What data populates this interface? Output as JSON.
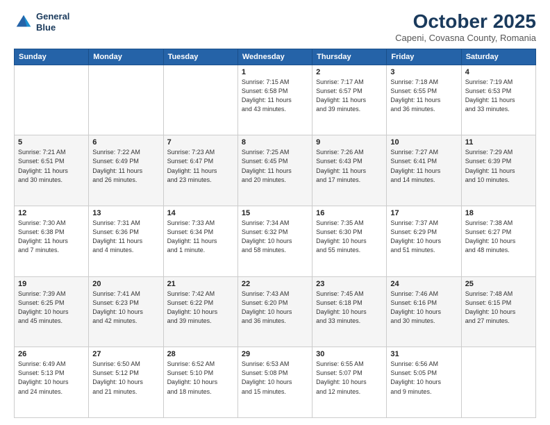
{
  "logo": {
    "line1": "General",
    "line2": "Blue"
  },
  "title": "October 2025",
  "subtitle": "Capeni, Covasna County, Romania",
  "days_header": [
    "Sunday",
    "Monday",
    "Tuesday",
    "Wednesday",
    "Thursday",
    "Friday",
    "Saturday"
  ],
  "weeks": [
    [
      {
        "num": "",
        "info": ""
      },
      {
        "num": "",
        "info": ""
      },
      {
        "num": "",
        "info": ""
      },
      {
        "num": "1",
        "info": "Sunrise: 7:15 AM\nSunset: 6:58 PM\nDaylight: 11 hours\nand 43 minutes."
      },
      {
        "num": "2",
        "info": "Sunrise: 7:17 AM\nSunset: 6:57 PM\nDaylight: 11 hours\nand 39 minutes."
      },
      {
        "num": "3",
        "info": "Sunrise: 7:18 AM\nSunset: 6:55 PM\nDaylight: 11 hours\nand 36 minutes."
      },
      {
        "num": "4",
        "info": "Sunrise: 7:19 AM\nSunset: 6:53 PM\nDaylight: 11 hours\nand 33 minutes."
      }
    ],
    [
      {
        "num": "5",
        "info": "Sunrise: 7:21 AM\nSunset: 6:51 PM\nDaylight: 11 hours\nand 30 minutes."
      },
      {
        "num": "6",
        "info": "Sunrise: 7:22 AM\nSunset: 6:49 PM\nDaylight: 11 hours\nand 26 minutes."
      },
      {
        "num": "7",
        "info": "Sunrise: 7:23 AM\nSunset: 6:47 PM\nDaylight: 11 hours\nand 23 minutes."
      },
      {
        "num": "8",
        "info": "Sunrise: 7:25 AM\nSunset: 6:45 PM\nDaylight: 11 hours\nand 20 minutes."
      },
      {
        "num": "9",
        "info": "Sunrise: 7:26 AM\nSunset: 6:43 PM\nDaylight: 11 hours\nand 17 minutes."
      },
      {
        "num": "10",
        "info": "Sunrise: 7:27 AM\nSunset: 6:41 PM\nDaylight: 11 hours\nand 14 minutes."
      },
      {
        "num": "11",
        "info": "Sunrise: 7:29 AM\nSunset: 6:39 PM\nDaylight: 11 hours\nand 10 minutes."
      }
    ],
    [
      {
        "num": "12",
        "info": "Sunrise: 7:30 AM\nSunset: 6:38 PM\nDaylight: 11 hours\nand 7 minutes."
      },
      {
        "num": "13",
        "info": "Sunrise: 7:31 AM\nSunset: 6:36 PM\nDaylight: 11 hours\nand 4 minutes."
      },
      {
        "num": "14",
        "info": "Sunrise: 7:33 AM\nSunset: 6:34 PM\nDaylight: 11 hours\nand 1 minute."
      },
      {
        "num": "15",
        "info": "Sunrise: 7:34 AM\nSunset: 6:32 PM\nDaylight: 10 hours\nand 58 minutes."
      },
      {
        "num": "16",
        "info": "Sunrise: 7:35 AM\nSunset: 6:30 PM\nDaylight: 10 hours\nand 55 minutes."
      },
      {
        "num": "17",
        "info": "Sunrise: 7:37 AM\nSunset: 6:29 PM\nDaylight: 10 hours\nand 51 minutes."
      },
      {
        "num": "18",
        "info": "Sunrise: 7:38 AM\nSunset: 6:27 PM\nDaylight: 10 hours\nand 48 minutes."
      }
    ],
    [
      {
        "num": "19",
        "info": "Sunrise: 7:39 AM\nSunset: 6:25 PM\nDaylight: 10 hours\nand 45 minutes."
      },
      {
        "num": "20",
        "info": "Sunrise: 7:41 AM\nSunset: 6:23 PM\nDaylight: 10 hours\nand 42 minutes."
      },
      {
        "num": "21",
        "info": "Sunrise: 7:42 AM\nSunset: 6:22 PM\nDaylight: 10 hours\nand 39 minutes."
      },
      {
        "num": "22",
        "info": "Sunrise: 7:43 AM\nSunset: 6:20 PM\nDaylight: 10 hours\nand 36 minutes."
      },
      {
        "num": "23",
        "info": "Sunrise: 7:45 AM\nSunset: 6:18 PM\nDaylight: 10 hours\nand 33 minutes."
      },
      {
        "num": "24",
        "info": "Sunrise: 7:46 AM\nSunset: 6:16 PM\nDaylight: 10 hours\nand 30 minutes."
      },
      {
        "num": "25",
        "info": "Sunrise: 7:48 AM\nSunset: 6:15 PM\nDaylight: 10 hours\nand 27 minutes."
      }
    ],
    [
      {
        "num": "26",
        "info": "Sunrise: 6:49 AM\nSunset: 5:13 PM\nDaylight: 10 hours\nand 24 minutes."
      },
      {
        "num": "27",
        "info": "Sunrise: 6:50 AM\nSunset: 5:12 PM\nDaylight: 10 hours\nand 21 minutes."
      },
      {
        "num": "28",
        "info": "Sunrise: 6:52 AM\nSunset: 5:10 PM\nDaylight: 10 hours\nand 18 minutes."
      },
      {
        "num": "29",
        "info": "Sunrise: 6:53 AM\nSunset: 5:08 PM\nDaylight: 10 hours\nand 15 minutes."
      },
      {
        "num": "30",
        "info": "Sunrise: 6:55 AM\nSunset: 5:07 PM\nDaylight: 10 hours\nand 12 minutes."
      },
      {
        "num": "31",
        "info": "Sunrise: 6:56 AM\nSunset: 5:05 PM\nDaylight: 10 hours\nand 9 minutes."
      },
      {
        "num": "",
        "info": ""
      }
    ]
  ]
}
